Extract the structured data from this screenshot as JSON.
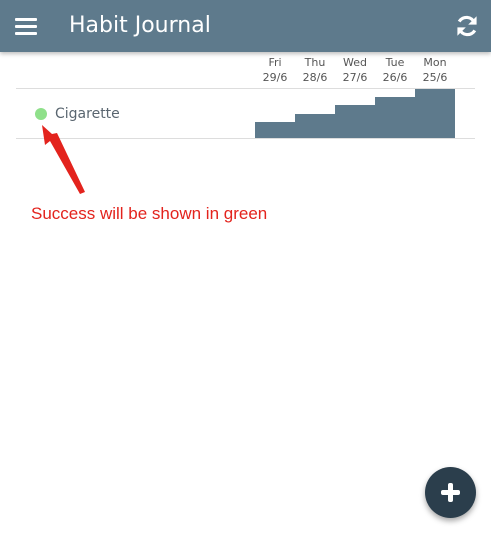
{
  "app_bar": {
    "title": "Habit Journal",
    "menu_icon": "hamburger-menu-icon",
    "refresh_icon": "refresh-icon",
    "background_color": "#5e7a8c"
  },
  "days": [
    {
      "day": "Fri",
      "date": "29/6"
    },
    {
      "day": "Thu",
      "date": "28/6"
    },
    {
      "day": "Wed",
      "date": "27/6"
    },
    {
      "day": "Tue",
      "date": "26/6"
    },
    {
      "day": "Mon",
      "date": "25/6"
    }
  ],
  "habits": [
    {
      "name": "Cigarette",
      "status_color": "#8fe08a",
      "level_by_day": [
        0.33,
        0.49,
        0.67,
        0.84,
        1.0
      ]
    }
  ],
  "annotation": {
    "text": "Success will be shown in green",
    "color": "#e3231d"
  },
  "fab": {
    "icon": "plus-icon",
    "background_color": "#2b3e4c"
  }
}
